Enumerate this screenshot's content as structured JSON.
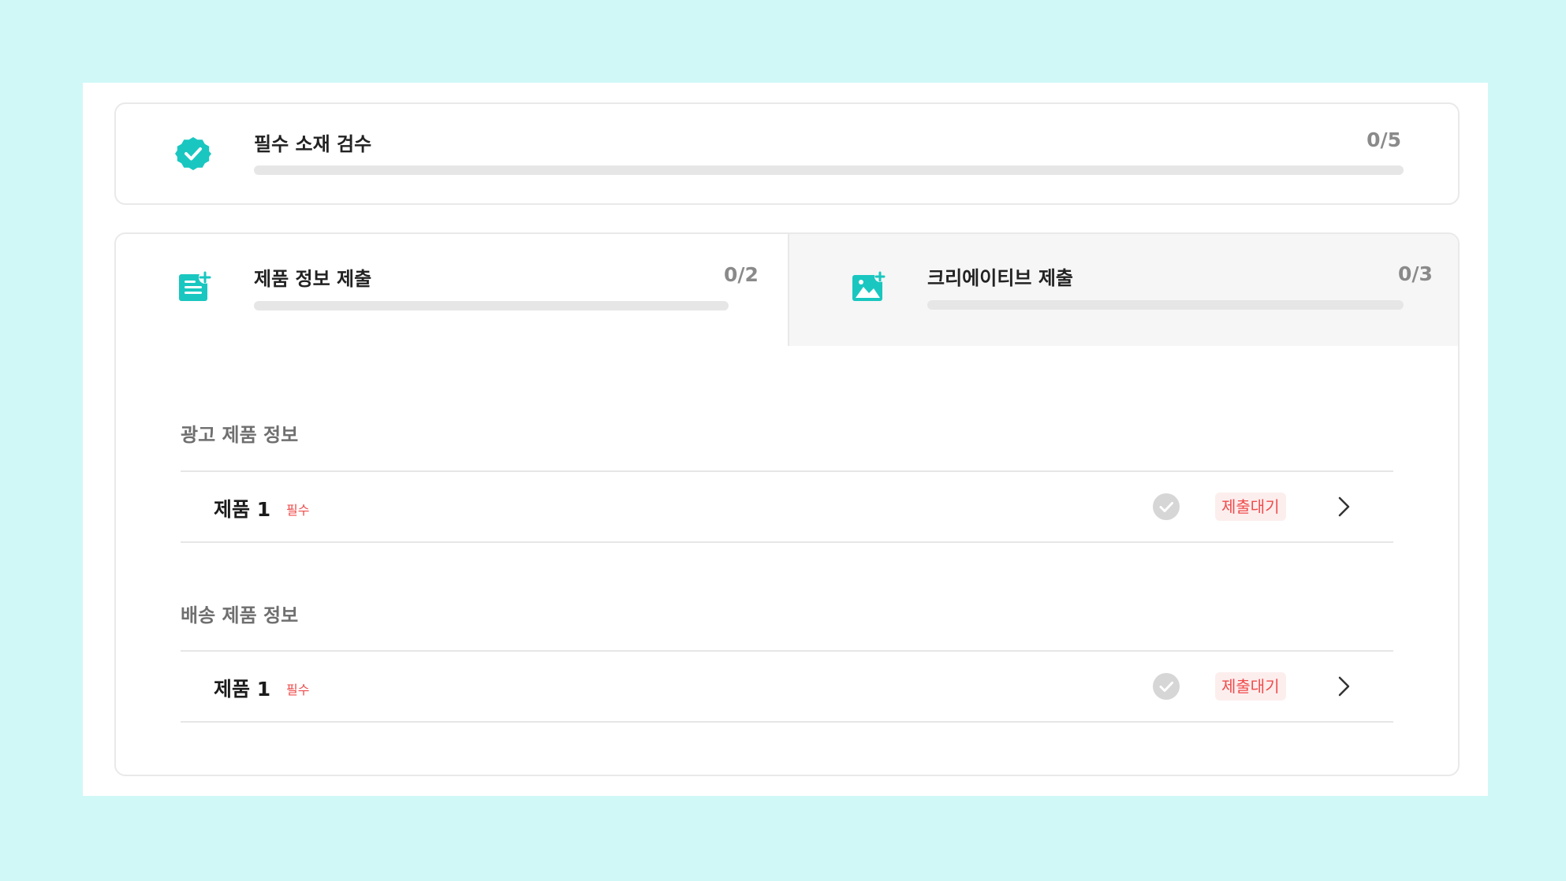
{
  "summary": {
    "icon": "verified-badge-icon",
    "title": "필수 소재 검수",
    "count": "0/5",
    "progress": 0
  },
  "tabs": [
    {
      "icon": "document-add-icon",
      "title": "제품 정보 제출",
      "count": "0/2",
      "progress": 0,
      "active": true
    },
    {
      "icon": "image-add-icon",
      "title": "크리에이티브 제출",
      "count": "0/3",
      "progress": 0,
      "active": false
    }
  ],
  "sections": [
    {
      "title": "광고 제품 정보",
      "items": [
        {
          "name": "제품 1",
          "required_label": "필수",
          "status": "제출대기"
        }
      ]
    },
    {
      "title": "배송 제품 정보",
      "items": [
        {
          "name": "제품 1",
          "required_label": "필수",
          "status": "제출대기"
        }
      ]
    }
  ],
  "colors": {
    "accent": "#19c7c0",
    "background": "#d0f8f7",
    "status_text": "#ef4b4b",
    "status_bg": "#fdeeee"
  }
}
